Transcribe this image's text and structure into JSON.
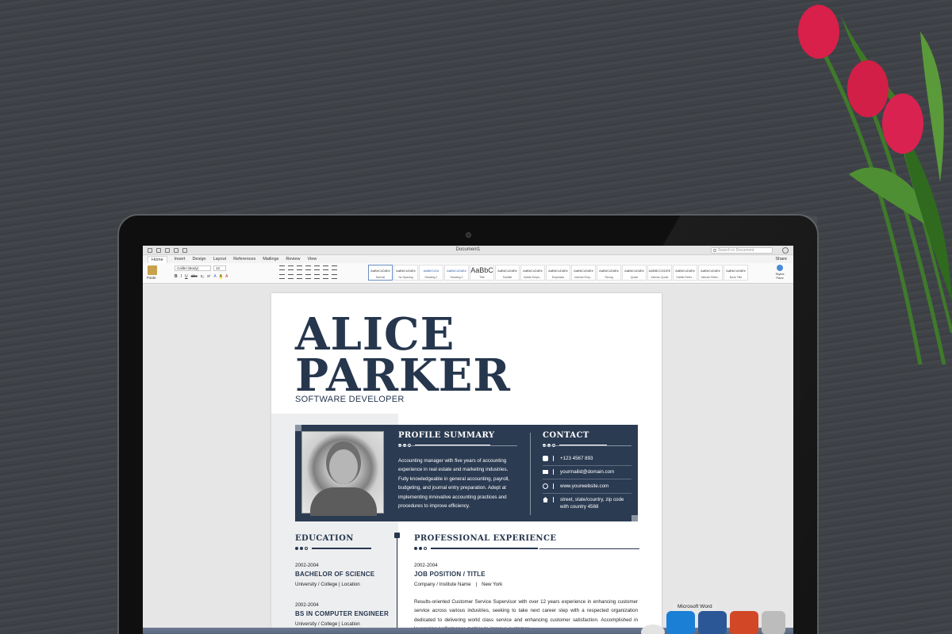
{
  "window": {
    "title": "Document1",
    "search_placeholder": "Search in Document"
  },
  "tabs": [
    "Home",
    "Insert",
    "Design",
    "Layout",
    "References",
    "Mailings",
    "Review",
    "View"
  ],
  "share_label": "Share",
  "ribbon": {
    "paste_label": "Paste",
    "font_name": "Calibri (Body)",
    "font_size": "12",
    "styles": [
      {
        "sample": "AaBbCcDdEe",
        "name": "Normal"
      },
      {
        "sample": "AaBbCcDdEe",
        "name": "No Spacing"
      },
      {
        "sample": "AaBbCcDd",
        "name": "Heading 1"
      },
      {
        "sample": "AaBbCcDdEe",
        "name": "Heading 2"
      },
      {
        "sample": "AaBbC",
        "name": "Title"
      },
      {
        "sample": "AaBbCcDdEe",
        "name": "Subtitle"
      },
      {
        "sample": "AaBbCcDdEe",
        "name": "Subtle Emph..."
      },
      {
        "sample": "AaBbCcDdEe",
        "name": "Emphasis"
      },
      {
        "sample": "AaBbCcDdEe",
        "name": "Intense Emp..."
      },
      {
        "sample": "AaBbCcDdEe",
        "name": "Strong"
      },
      {
        "sample": "AaBbCcDdEe",
        "name": "Quote"
      },
      {
        "sample": "AABBCCDDEE",
        "name": "Intense Quote"
      },
      {
        "sample": "AaBbCcDdEe",
        "name": "Subtle Refer..."
      },
      {
        "sample": "AaBbCcDdEe",
        "name": "Intense Refer..."
      },
      {
        "sample": "AaBbCcDdEe",
        "name": "Book Title"
      }
    ],
    "styles_pane_label": "Styles Pane"
  },
  "resume": {
    "first_name": "ALICE",
    "last_name": "PARKER",
    "role": "SOFTWARE DEVELOPER",
    "profile_title": "PROFILE SUMMARY",
    "profile_text": "Accounting manager with five years of accounting experience in real estate and marketing industries. Fully knowledgeable in general accounting, payroll, budgeting, and journal entry preparation. Adept at implementing innovative accounting practices and procedures to improve efficiency.",
    "contact_title": "CONTACT",
    "contact": {
      "phone": "+123 4567 893",
      "email": "yourmailid@domain.com",
      "website": "www.yourwebsite.com",
      "address": "street, state/country, zip code with country 4568"
    },
    "education_title": "EDUCATION",
    "education": [
      {
        "years": "2002-2004",
        "degree": "BACHELOR OF SCIENCE",
        "place": "University / College | Location"
      },
      {
        "years": "2002-2004",
        "degree": "BS IN COMPUTER ENGINEER",
        "place": "University / College | Location"
      }
    ],
    "experience_title": "PROFESSIONAL EXPERIENCE",
    "experience": {
      "years": "2002-2004",
      "position": "JOB POSITION / TITLE",
      "company": "Company / Institute Name",
      "sep": "|",
      "city": "New York",
      "text": "Results-oriented Customer Service Supervisor with over 12 years experience in enhancing customer service across various industries, seeking to take next career step with a respected organization dedicated to delivering world class service and enhancing customer satisfaction. Accomplished in leveraging performance metrics to improve customer."
    }
  },
  "dock": {
    "tooltip": "Microsoft Word"
  },
  "colors": {
    "navy": "#2b3b52",
    "accent_text": "#26364d"
  }
}
